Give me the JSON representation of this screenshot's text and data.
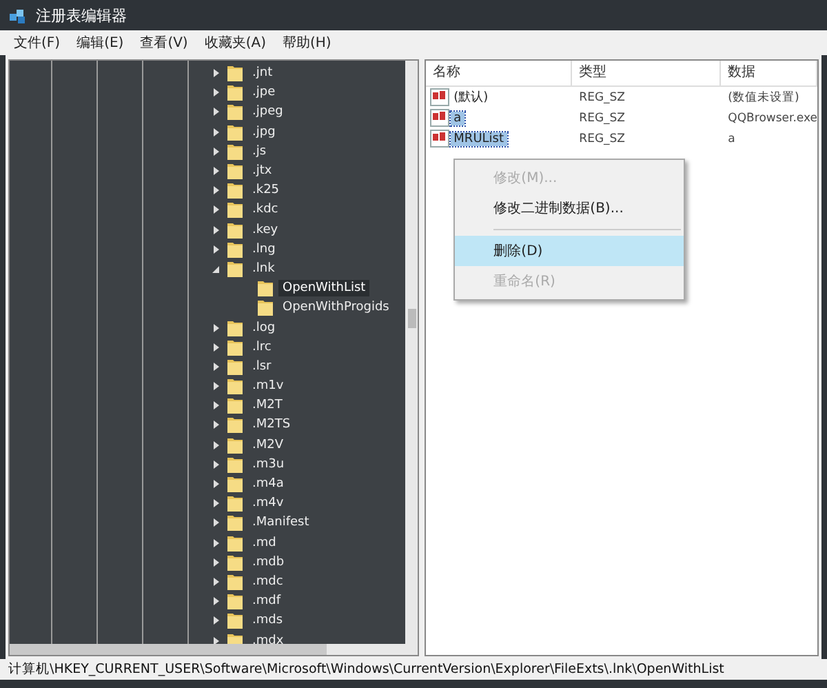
{
  "window": {
    "title": "注册表编辑器"
  },
  "menu_bar": [
    "文件(F)",
    "编辑(E)",
    "查看(V)",
    "收藏夹(A)",
    "帮助(H)"
  ],
  "tree": [
    {
      "label": ".jnt",
      "expanded": false
    },
    {
      "label": ".jpe",
      "expanded": false
    },
    {
      "label": ".jpeg",
      "expanded": false
    },
    {
      "label": ".jpg",
      "expanded": false
    },
    {
      "label": ".js",
      "expanded": false
    },
    {
      "label": ".jtx",
      "expanded": false
    },
    {
      "label": ".k25",
      "expanded": false
    },
    {
      "label": ".kdc",
      "expanded": false
    },
    {
      "label": ".key",
      "expanded": false
    },
    {
      "label": ".lng",
      "expanded": false
    },
    {
      "label": ".lnk",
      "expanded": true,
      "children": [
        {
          "label": "OpenWithList",
          "selected": true
        },
        {
          "label": "OpenWithProgids",
          "selected": false
        }
      ]
    },
    {
      "label": ".log",
      "expanded": false
    },
    {
      "label": ".lrc",
      "expanded": false
    },
    {
      "label": ".lsr",
      "expanded": false
    },
    {
      "label": ".m1v",
      "expanded": false
    },
    {
      "label": ".M2T",
      "expanded": false
    },
    {
      "label": ".M2TS",
      "expanded": false
    },
    {
      "label": ".M2V",
      "expanded": false
    },
    {
      "label": ".m3u",
      "expanded": false
    },
    {
      "label": ".m4a",
      "expanded": false
    },
    {
      "label": ".m4v",
      "expanded": false
    },
    {
      "label": ".Manifest",
      "expanded": false
    },
    {
      "label": ".md",
      "expanded": false
    },
    {
      "label": ".mdb",
      "expanded": false
    },
    {
      "label": ".mdc",
      "expanded": false
    },
    {
      "label": ".mdf",
      "expanded": false
    },
    {
      "label": ".mds",
      "expanded": false
    },
    {
      "label": ".mdx",
      "expanded": false
    }
  ],
  "values": {
    "columns": [
      "名称",
      "类型",
      "数据"
    ],
    "rows": [
      {
        "name": "(默认)",
        "type": "REG_SZ",
        "data": "(数值未设置)",
        "selected": false
      },
      {
        "name": "a",
        "type": "REG_SZ",
        "data": "QQBrowser.exe",
        "selected": true
      },
      {
        "name": "MRUList",
        "type": "REG_SZ",
        "data": "a",
        "selected": true
      }
    ]
  },
  "context_menu": [
    {
      "kind": "item",
      "label": "修改(M)...",
      "disabled": true,
      "selected": false
    },
    {
      "kind": "item",
      "label": "修改二进制数据(B)...",
      "disabled": false,
      "selected": false
    },
    {
      "kind": "separator"
    },
    {
      "kind": "item",
      "label": "删除(D)",
      "disabled": false,
      "selected": true
    },
    {
      "kind": "item",
      "label": "重命名(R)",
      "disabled": true,
      "selected": false
    }
  ],
  "status_bar": "计算机\\HKEY_CURRENT_USER\\Software\\Microsoft\\Windows\\CurrentVersion\\Explorer\\FileExts\\.lnk\\OpenWithList"
}
